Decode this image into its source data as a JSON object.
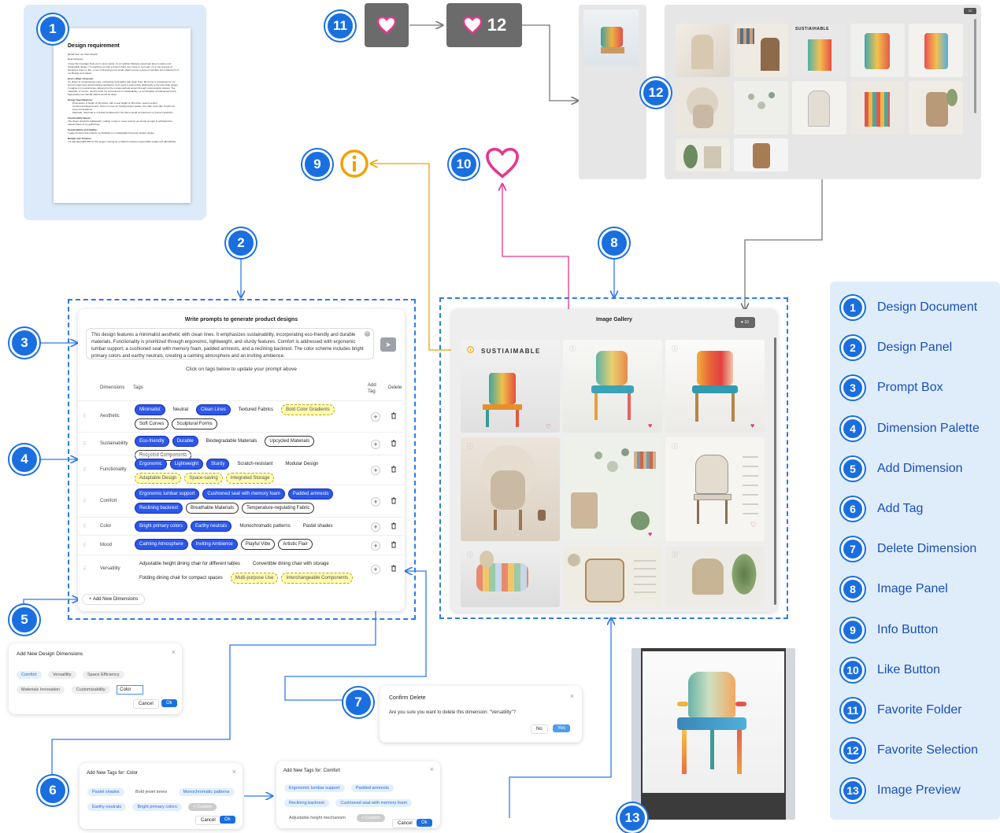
{
  "badges": [
    "1",
    "2",
    "3",
    "4",
    "5",
    "6",
    "7",
    "8",
    "9",
    "10",
    "11",
    "12",
    "13"
  ],
  "doc": {
    "title": "Design requirement",
    "email_from": "[Email from our client David]",
    "greeting": "Dear Designer,",
    "p1": "I hope this message finds you in great spirits. As an ambient lifestyle passionate about modern and sustainable design, I'm reaching out with a project that's very close to my heart. I'm in the process of bringing a vision to life—a set of 10 dining room chairs that'll not just a piece of furniture but a statement of my lifestyle and values.",
    "h1": "Here's What I Envision:",
    "p2": "I'm drawn to contemporary style, embracing minimalism with clean lines. My home is a testament to my love for clean lines and functional aesthetics, and I want to extend this philosophy to the new chair design. I imagine it in neutral tones, allowing for the occasional bold accent through customization options. The materials, of course, need to echo my commitment to sustainability—a combination of natural wood and high-quality eco-friendly fabrics would be ideal.",
    "h2": "Design Specifications:",
    "b1": "Dimensions: A height of 36 inches, with a seat height of 18 inches, seems perfect.",
    "b2": "Comfort and Ergonomics: Given my love for hosting dinner parties, the chair must offer comfort for long conversations.",
    "b3": "Materials: Solid oak or a similar hardwood for the frame would complement my home's aesthetic.",
    "h3": "Functionality Needs:",
    "p3": "The chairs should be lightweight, making it easy to move around, yet sturdy enough to withstand the casual chaos of my gatherings.",
    "h4": "Sustainability and Quality:",
    "p4": "I value furniture that reflects my dedication to sustainable living and modern design.",
    "h5": "Budget and Timeline:",
    "p5": "I've allocated $20,000 for this project, aiming for a balance between responsible quality and affordability."
  },
  "fav": {
    "count": "12"
  },
  "prompt": {
    "title": "Write prompts to generate product designs",
    "text": "This design features a minimalist aesthetic with clean lines. It emphasizes sustainability, incorporating eco-friendly and durable materials. Functionality is prioritized through ergonomic, lightweight, and sturdy features. Comfort is addressed with ergonomic lumbar support, a cushioned seat with memory foam, padded armrests, and a reclining backrest. The color scheme includes bright primary colors and earthy neutrals, creating a calming atmosphere and an inviting ambience.",
    "hint": "Click on tags below to update your prompt above",
    "col_dim": "Dimensions",
    "col_tags": "Tags",
    "col_add": "Add Tag",
    "col_del": "Delete",
    "add_dim": "+ Add New Dimensions",
    "rows": [
      {
        "name": "Aesthetic",
        "tags": [
          [
            "Minimalist",
            "s"
          ],
          [
            "Neutral",
            "p"
          ],
          [
            "Clean Lines",
            "s"
          ],
          [
            "Textured Fabrics",
            "p"
          ],
          [
            "Bold Color Gradients",
            "n"
          ],
          [
            "Soft Curves",
            "o"
          ],
          [
            "Sculptural Forms",
            "o"
          ]
        ]
      },
      {
        "name": "Sustainability",
        "tags": [
          [
            "Eco-friendly",
            "s"
          ],
          [
            "Durable",
            "s"
          ],
          [
            "Biodegradable Materials",
            "p"
          ],
          [
            "Upcycled Materials",
            "o"
          ],
          [
            "Recycled Components",
            "o"
          ]
        ]
      },
      {
        "name": "Functionality",
        "tags": [
          [
            "Ergonomic",
            "s"
          ],
          [
            "Lightweight",
            "s"
          ],
          [
            "Sturdy",
            "s"
          ],
          [
            "Scratch-resistant",
            "p"
          ],
          [
            "Modular Design",
            "p"
          ],
          [
            "Adaptable Design",
            "n"
          ],
          [
            "Space-saving",
            "n"
          ],
          [
            "Integrated Storage",
            "n"
          ]
        ]
      },
      {
        "name": "Comfort",
        "tags": [
          [
            "Ergonomic lumbar support",
            "s"
          ],
          [
            "Cushioned seat with memory foam",
            "s"
          ],
          [
            "Padded armrests",
            "s"
          ],
          [
            "Reclining backrest",
            "s"
          ],
          [
            "Breathable Materials",
            "o"
          ],
          [
            "Temperature-regulating Fabric",
            "o"
          ]
        ]
      },
      {
        "name": "Color",
        "tags": [
          [
            "Bright primary colors",
            "s"
          ],
          [
            "Earthy neutrals",
            "s"
          ],
          [
            "Monochromatic patterns",
            "p"
          ],
          [
            "Pastel shades",
            "p"
          ]
        ]
      },
      {
        "name": "Mood",
        "tags": [
          [
            "Calming Atmosphere",
            "s"
          ],
          [
            "Inviting Ambience",
            "s"
          ],
          [
            "Playful Vibe",
            "o"
          ],
          [
            "Artistic Flair",
            "o"
          ]
        ]
      },
      {
        "name": "Versatility",
        "tags": [
          [
            "Adjustable height dining chair for different tables",
            "p"
          ],
          [
            "Convertible dining chair with storage",
            "p"
          ],
          [
            "Folding dining chair for compact spaces",
            "p"
          ],
          [
            "Multi-purpose Use",
            "n"
          ],
          [
            "Interchangeable Components",
            "n"
          ]
        ]
      }
    ]
  },
  "gallery": {
    "title": "Image Gallery",
    "fav_count": "10",
    "sustainable": "SUSTIAIMABLE"
  },
  "fav_grid": {
    "count": "10",
    "sustainable": "SUSTIAIHABLE"
  },
  "add_dim_dialog": {
    "title": "Add New Design Dimensions",
    "pills": [
      "Comfort",
      "Versatility",
      "Space Efficiency",
      "Materials Innovation",
      "Customizability"
    ],
    "input": "Color",
    "cancel": "Cancel",
    "ok": "Ok"
  },
  "confirm": {
    "title": "Confirm Delete",
    "msg": "Are you sure you want to delete this dimension: \"Versatility\"?",
    "no": "No",
    "yes": "Yes"
  },
  "tag_color": {
    "title": "Add New Tags for: Color",
    "pills": [
      "Pastel shades",
      "Bold jewel tones",
      "Monochromatic patterns",
      "Earthy neutrals",
      "Bright primary colors"
    ],
    "custom": "+ Custom",
    "cancel": "Cancel",
    "ok": "Ok"
  },
  "tag_comfort": {
    "title": "Add New Tags for: Comfort",
    "pills": [
      "Ergonomic lumbar support",
      "Padded armrests",
      "Reclining backrest",
      "Cushioned seat with memory foam",
      "Adjustable height mechanism"
    ],
    "custom": "+ Custom",
    "cancel": "Cancel",
    "ok": "Ok"
  },
  "legend": [
    "Design Document",
    "Design Panel",
    "Prompt Box",
    "Dimension Palette",
    "Add Dimension",
    "Add Tag",
    "Delete Dimension",
    "Image Panel",
    "Info Button",
    "Like Button",
    "Favorite Folder",
    "Favorite Selection",
    "Image Preview"
  ]
}
